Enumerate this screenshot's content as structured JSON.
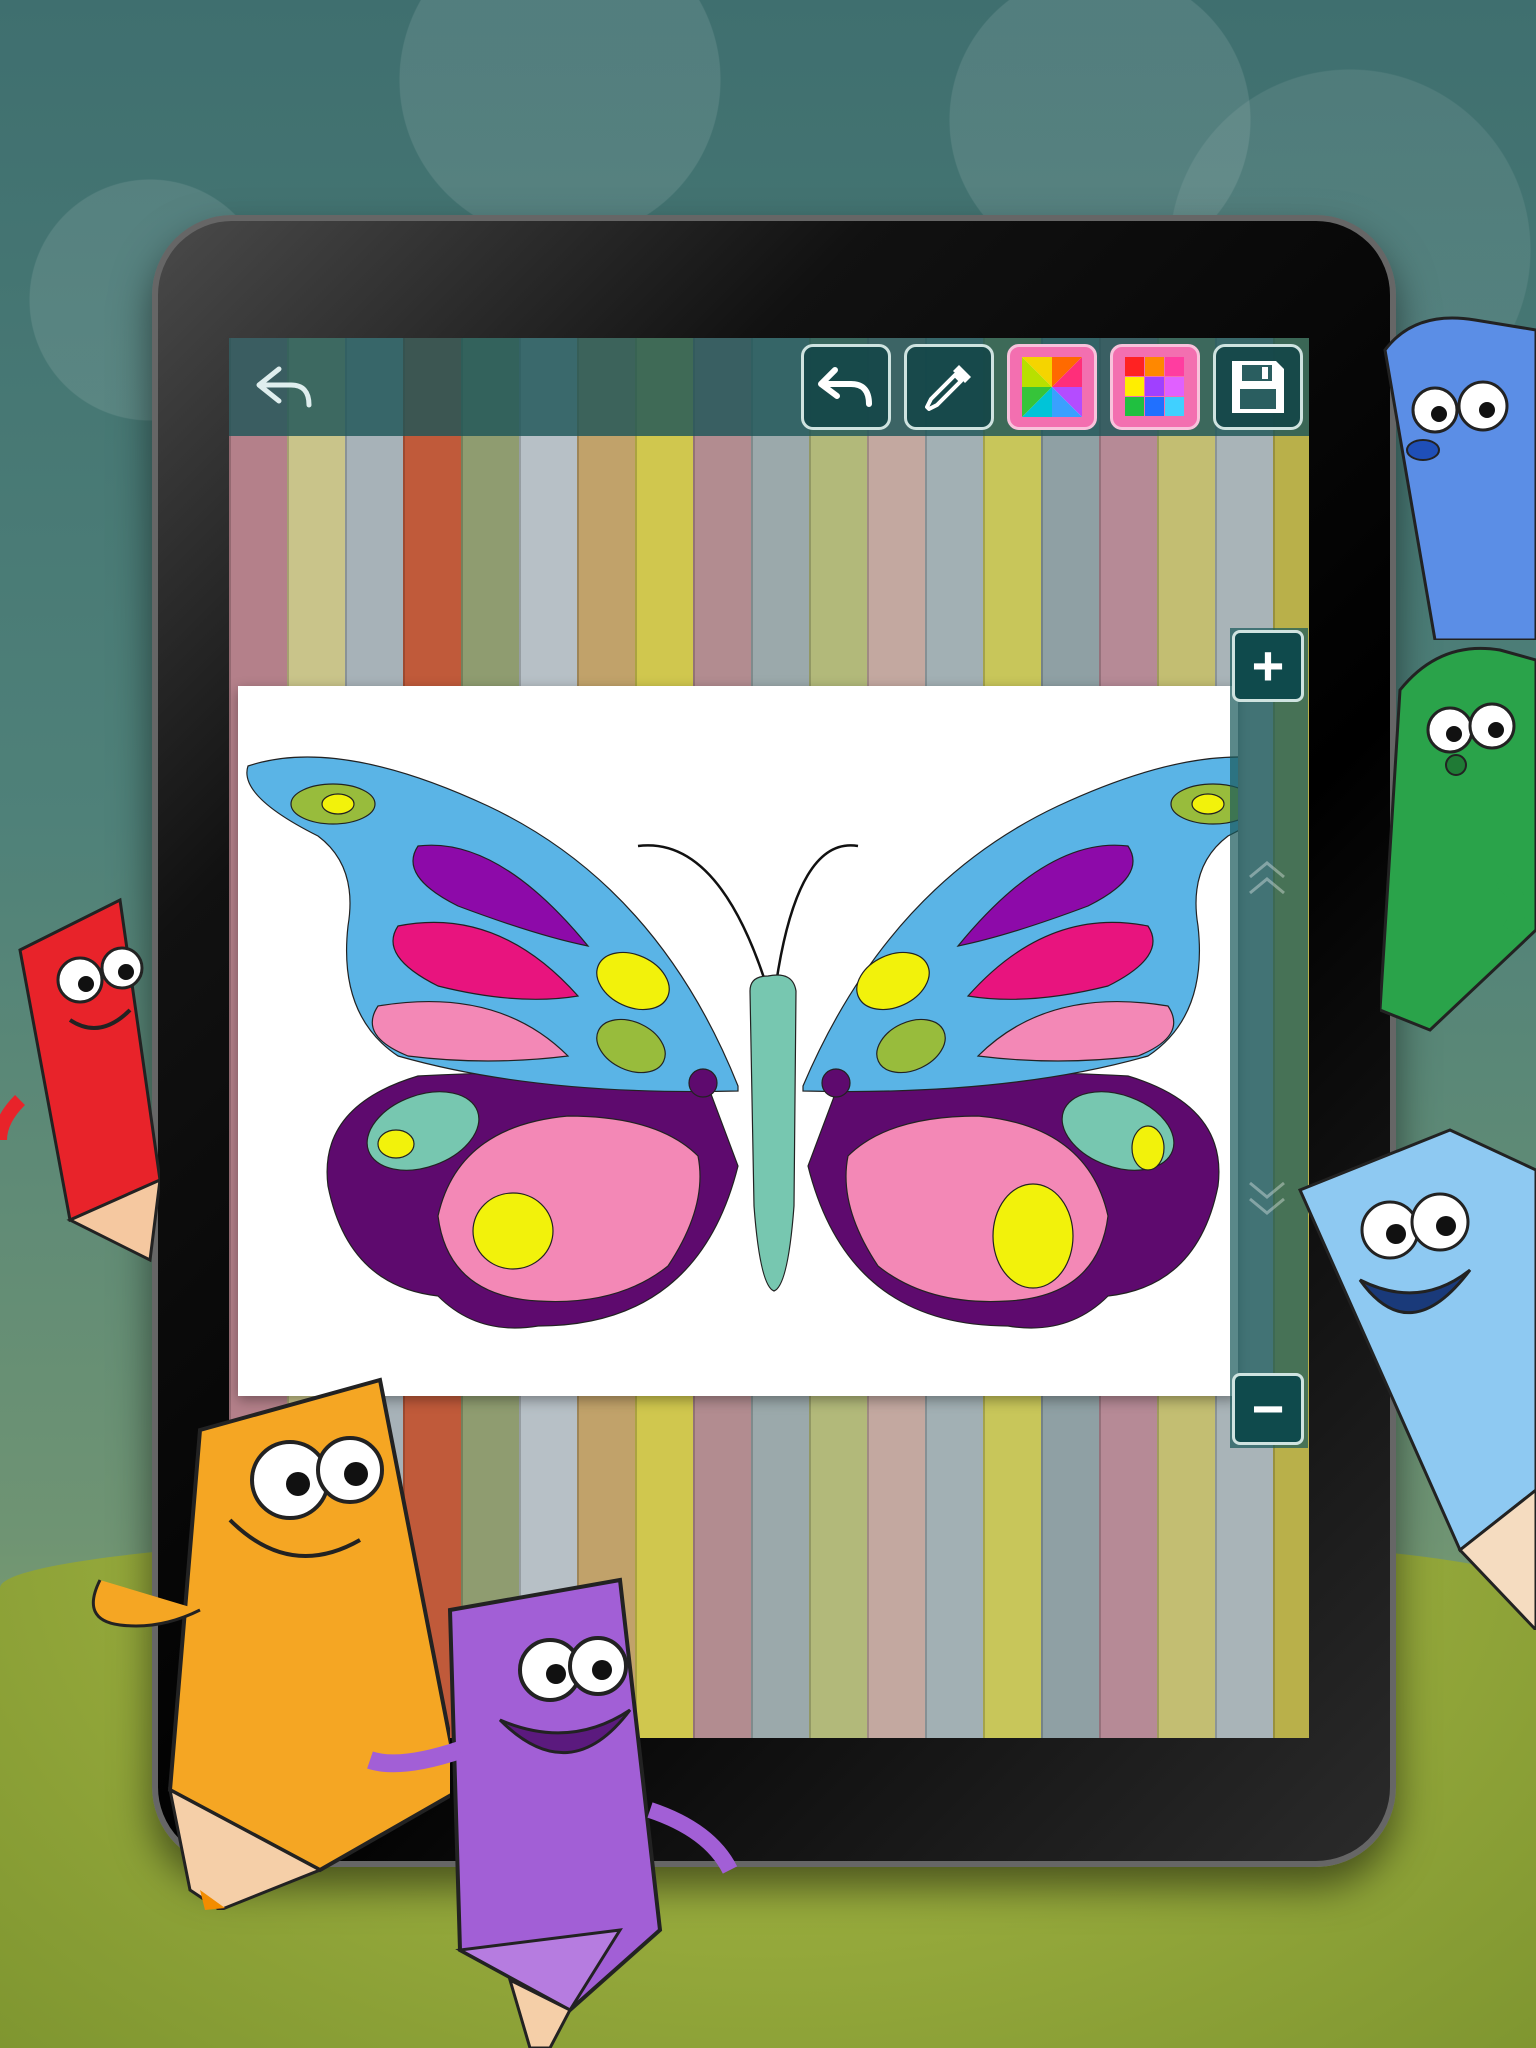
{
  "toolbar": {
    "back": "back-arrow-icon",
    "undo": "undo-icon",
    "eyedropper": "eyedropper-icon",
    "color_wheel": "color-wheel-icon",
    "color_palette": "color-palette-icon",
    "save": "floppy-disk-icon"
  },
  "zoom": {
    "zoom_in_label": "+",
    "zoom_out_label": "−",
    "scroll_up": "double-chevron-up-icon",
    "scroll_down": "double-chevron-down-icon"
  },
  "drawing": {
    "subject": "butterfly",
    "colors": {
      "upper_wing": "#5ab4e6",
      "lower_wing": "#5e0a6e",
      "pink": "#f388b6",
      "magenta": "#e8147e",
      "violet": "#8d0aa9",
      "yellow": "#f2f20b",
      "olive": "#98bc3c",
      "teal": "#77c7b0"
    }
  },
  "characters": [
    "red-pencil",
    "blue-pencil",
    "green-pencil",
    "light-blue-pencil",
    "orange-pencil",
    "purple-pencil"
  ]
}
